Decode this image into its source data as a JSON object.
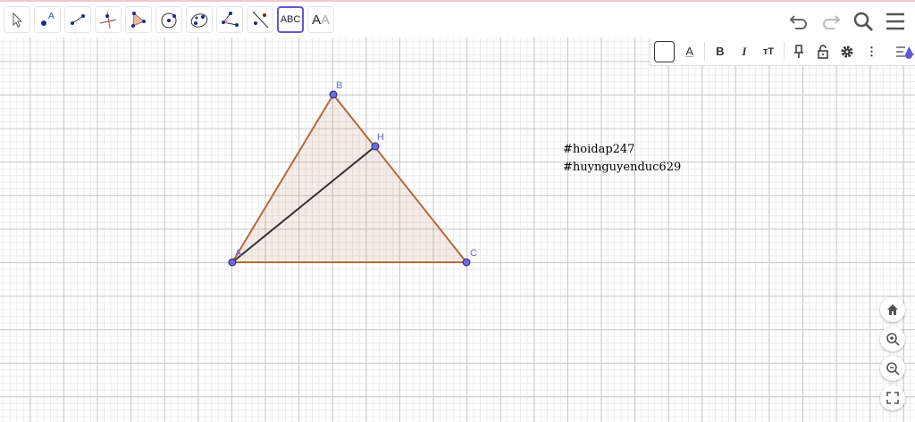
{
  "toolbar": {
    "tools": [
      "move",
      "point",
      "segment",
      "perpendicular-line",
      "polygon",
      "circle-center-point",
      "conic-5-points",
      "angle",
      "reflect-about-line",
      "text",
      "slider-text-size"
    ],
    "text_tool_label": "ABC",
    "aa_label_a": "A",
    "aa_label_b": "A"
  },
  "stylebar": {
    "text_color_label": "A",
    "bold_label": "B",
    "italic_label": "I",
    "size_label": "тT",
    "more_label": "⋮"
  },
  "construction": {
    "points": {
      "A": "A",
      "B": "B",
      "C": "C",
      "H": "H"
    },
    "polygon_fill": "#b3694233",
    "polygon_stroke": "#b36942",
    "segment_color": "#333333",
    "point_color": "#6a6ad8"
  },
  "texts": [
    "#hoidap247",
    "#huynguyenduc629"
  ],
  "colors": {
    "accent": "#6557d2"
  }
}
